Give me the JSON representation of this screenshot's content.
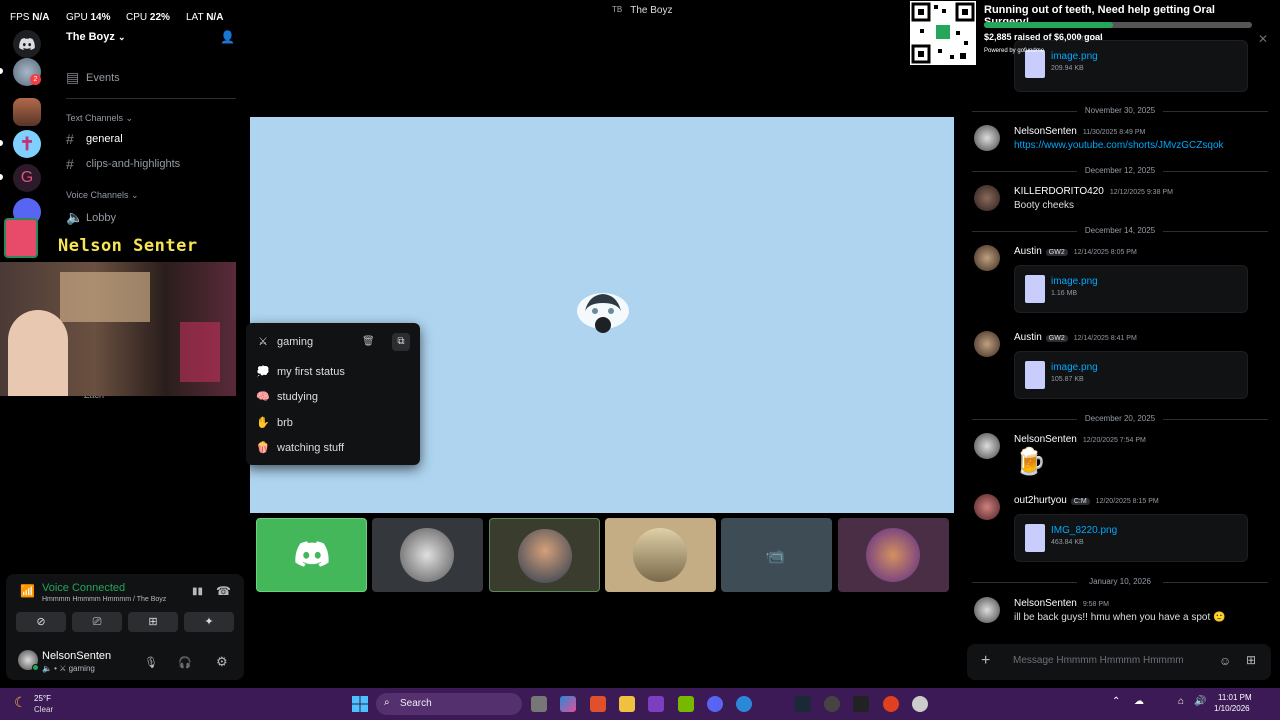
{
  "stats": {
    "fps_label": "FPS",
    "fps": "N/A",
    "gpu_label": "GPU",
    "gpu": "14",
    "cpu_label": "CPU",
    "cpu": "22",
    "pct": "%",
    "lat_label": "LAT",
    "lat": "N/A"
  },
  "window": {
    "badge": "TB",
    "title": "The Boyz"
  },
  "server": {
    "name": "The Boyz",
    "events": "Events",
    "text_category": "Text Channels",
    "text_channels": [
      "general",
      "clips-and-highlights"
    ],
    "voice_category": "Voice Channels",
    "voice_channels": [
      "Lobby"
    ],
    "voice_member": "Zach",
    "rail_badge": "2"
  },
  "voice_panel": {
    "title": "Voice Connected",
    "subtitle": "Hmmmm Hmmmm Hmmmm / The Boyz",
    "user_name": "NelsonSenten",
    "user_status": "gaming"
  },
  "webcam": {
    "banner_name": "Nelson Senter"
  },
  "status_menu": {
    "current": "gaming",
    "items": [
      "my first status",
      "studying",
      "brb",
      "watching stuff"
    ]
  },
  "donation": {
    "title": "Running out of teeth, Need help getting Oral Surgery!",
    "raised_text": "$2,885 raised of $6,000 goal",
    "progress": 0.48,
    "powered": "Powered by gofundme"
  },
  "chat": {
    "top_attachment": {
      "name": "image.png",
      "size": "209.94 KB"
    },
    "header_ghost": "mmm",
    "dates": [
      "November 30, 2025",
      "December 12, 2025",
      "December 14, 2025",
      "December 20, 2025",
      "January 10, 2026"
    ],
    "messages": [
      {
        "author": "NelsonSenten",
        "time": "11/30/2025 8:49 PM",
        "text": "https://www.youtube.com/shorts/JMvzGCZsqok"
      },
      {
        "author": "KILLERDORITO420",
        "time": "12/12/2025 9:38 PM",
        "text": "Booty cheeks"
      },
      {
        "author": "Austin",
        "tag": "GW2",
        "time": "12/14/2025 8:05 PM",
        "file": "image.png",
        "size": "1.16 MB"
      },
      {
        "author": "Austin",
        "tag": "GW2",
        "time": "12/14/2025 8:41 PM",
        "file": "image.png",
        "size": "105.87 KB"
      },
      {
        "author": "NelsonSenten",
        "time": "12/20/2025 7:54 PM",
        "text": "🍺"
      },
      {
        "author": "out2hurtyou",
        "tag": "C:M",
        "time": "12/20/2025 8:15 PM",
        "file": "IMG_8220.png",
        "size": "463.84 KB"
      },
      {
        "author": "NelsonSenten",
        "time": "9:58 PM",
        "text": "ill be back guys!! hmu when you have a spot 🙂"
      }
    ],
    "composer_placeholder": "Message Hmmmm Hmmmm Hmmmm"
  },
  "taskbar": {
    "temp": "25°F",
    "weather": "Clear",
    "search": "Search",
    "time": "11:01 PM",
    "date": "1/10/2026"
  },
  "colors": {
    "accent": "#5865f2",
    "online": "#23a55a",
    "stage": "#aed4ef",
    "taskbar": "#3b1a55"
  }
}
